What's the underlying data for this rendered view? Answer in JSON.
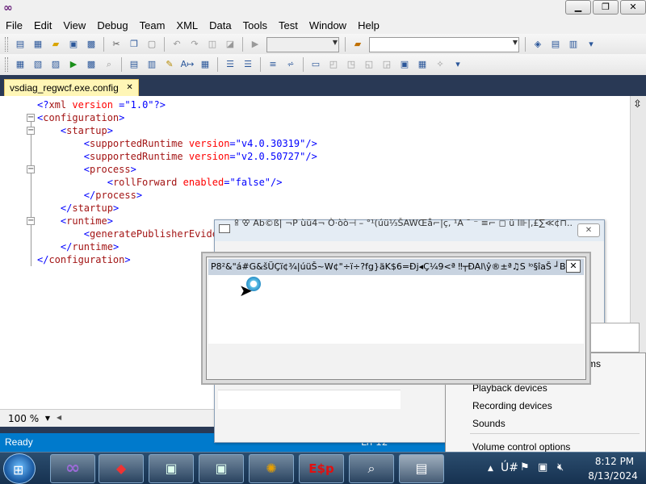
{
  "window": {
    "buttons": {
      "minimize": "▁",
      "restore": "❐",
      "close": "✕"
    }
  },
  "menu": [
    "File",
    "Edit",
    "View",
    "Debug",
    "Team",
    "XML",
    "Data",
    "Tools",
    "Test",
    "Window",
    "Help"
  ],
  "document": {
    "tab_label": "vsdiag_regwcf.exe.config",
    "tab_close": "✕"
  },
  "xml_lines": [
    {
      "indent": 0,
      "parts": [
        [
          "b",
          "<?"
        ],
        [
          "t",
          "xml"
        ],
        [
          "a",
          " version"
        ],
        [
          "b",
          " ="
        ],
        [
          "v",
          "\"1.0\""
        ],
        [
          "b",
          "?>"
        ]
      ]
    },
    {
      "indent": 0,
      "parts": [
        [
          "b",
          "<"
        ],
        [
          "t",
          "configuration"
        ],
        [
          "b",
          ">"
        ]
      ]
    },
    {
      "indent": 1,
      "parts": [
        [
          "b",
          "<"
        ],
        [
          "t",
          "startup"
        ],
        [
          "b",
          ">"
        ]
      ]
    },
    {
      "indent": 2,
      "parts": [
        [
          "b",
          "<"
        ],
        [
          "t",
          "supportedRuntime"
        ],
        [
          "a",
          " version"
        ],
        [
          "b",
          "="
        ],
        [
          "v",
          "\"v4.0.30319\""
        ],
        [
          "b",
          "/>"
        ]
      ]
    },
    {
      "indent": 2,
      "parts": [
        [
          "b",
          "<"
        ],
        [
          "t",
          "supportedRuntime"
        ],
        [
          "a",
          " version"
        ],
        [
          "b",
          "="
        ],
        [
          "v",
          "\"v2.0.50727\""
        ],
        [
          "b",
          "/>"
        ]
      ]
    },
    {
      "indent": 2,
      "parts": [
        [
          "b",
          "<"
        ],
        [
          "t",
          "process"
        ],
        [
          "b",
          ">"
        ]
      ]
    },
    {
      "indent": 3,
      "parts": [
        [
          "b",
          "<"
        ],
        [
          "t",
          "rollForward"
        ],
        [
          "a",
          " enabled"
        ],
        [
          "b",
          "="
        ],
        [
          "v",
          "\"false\""
        ],
        [
          "b",
          "/>"
        ]
      ]
    },
    {
      "indent": 2,
      "parts": [
        [
          "b",
          "</"
        ],
        [
          "t",
          "process"
        ],
        [
          "b",
          ">"
        ]
      ]
    },
    {
      "indent": 1,
      "parts": [
        [
          "b",
          "</"
        ],
        [
          "t",
          "startup"
        ],
        [
          "b",
          ">"
        ]
      ]
    },
    {
      "indent": 1,
      "parts": [
        [
          "b",
          "<"
        ],
        [
          "t",
          "runtime"
        ],
        [
          "b",
          ">"
        ]
      ]
    },
    {
      "indent": 2,
      "parts": [
        [
          "b",
          "<"
        ],
        [
          "t",
          "generatePublisherEviden"
        ]
      ]
    },
    {
      "indent": 1,
      "parts": [
        [
          "b",
          "</"
        ],
        [
          "t",
          "runtime"
        ],
        [
          "b",
          ">"
        ]
      ]
    },
    {
      "indent": 0,
      "parts": [
        [
          "b",
          "</"
        ],
        [
          "t",
          "configuration"
        ],
        [
          "b",
          ">"
        ]
      ]
    }
  ],
  "zoom": {
    "value": "100 %"
  },
  "status": {
    "text": "Ready",
    "line": "Ln 12"
  },
  "dialog_back": {
    "title": "ꕉ ꕢ Ab©ß| ¬P ùü4¬ Ò·òò⊣ – °¹(úü⅓ŠAWŒå⌐|ç, ¹A ¯ ⁻ ≡⌐ ◻ ü l⊪|,£∑≪¢⊓...",
    "close": "✕"
  },
  "dialog_front": {
    "title": "P8²&\"á#G&šÜÇï¢¾|úüŠ~W¢\"÷ï÷?fg}äK$6=Ðj◂Ç¼9<ª     ‼┬ÐAl\\ŷ®±ª♫S ˡᵒ§îaŠ ┘Bá...",
    "close": "✕"
  },
  "context_menu": {
    "partial_item": "ms",
    "items": [
      "Playback devices",
      "Recording devices",
      "Sounds",
      "Volume control options"
    ]
  },
  "tray": {
    "ime": "Ú#",
    "time": "8:12 PM",
    "date": "8/13/2024"
  },
  "taskbar_icons": {
    "vs": "∞",
    "espr": "E$p"
  }
}
